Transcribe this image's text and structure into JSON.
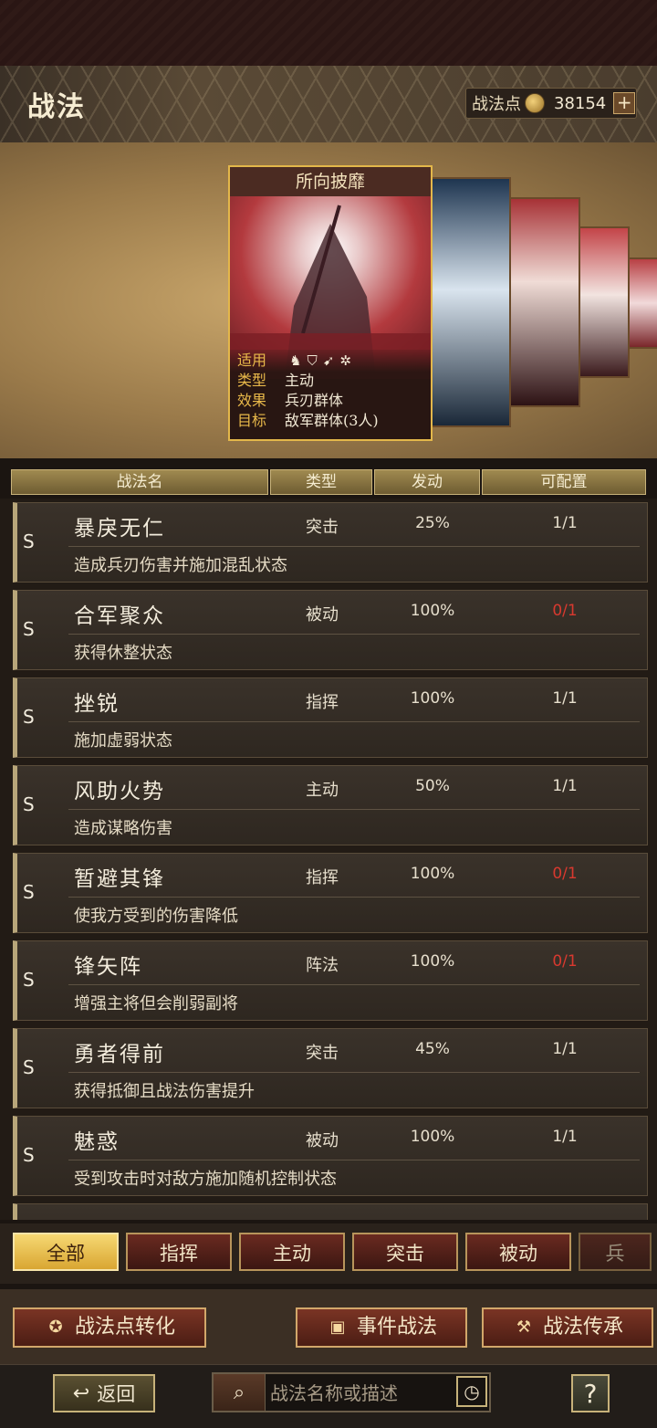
{
  "header": {
    "title": "战法",
    "points_label": "战法点",
    "points_value": "38154",
    "plus_icon": "plus-icon",
    "coin_icon": "coin-icon"
  },
  "featured": {
    "name": "所向披靡",
    "rows": [
      {
        "key": "适用",
        "value": ""
      },
      {
        "key": "类型",
        "value": "主动"
      },
      {
        "key": "效果",
        "value": "兵刃群体"
      },
      {
        "key": "目标",
        "value": "敌军群体(3人)"
      }
    ],
    "applicable_icons": [
      "cavalry-icon",
      "shield-icon",
      "bow-icon",
      "wheel-icon"
    ]
  },
  "columns": {
    "name": "战法名",
    "type": "类型",
    "rate": "发动",
    "config": "可配置"
  },
  "skills": [
    {
      "grade": "S",
      "name": "暴戾无仁",
      "type": "突击",
      "rate": "25%",
      "config": "1/1",
      "config_red": false,
      "desc": "造成兵刃伤害并施加混乱状态"
    },
    {
      "grade": "S",
      "name": "合军聚众",
      "type": "被动",
      "rate": "100%",
      "config": "0/1",
      "config_red": true,
      "desc": "获得休整状态"
    },
    {
      "grade": "S",
      "name": "挫锐",
      "type": "指挥",
      "rate": "100%",
      "config": "1/1",
      "config_red": false,
      "desc": "施加虚弱状态"
    },
    {
      "grade": "S",
      "name": "风助火势",
      "type": "主动",
      "rate": "50%",
      "config": "1/1",
      "config_red": false,
      "desc": "造成谋略伤害"
    },
    {
      "grade": "S",
      "name": "暂避其锋",
      "type": "指挥",
      "rate": "100%",
      "config": "0/1",
      "config_red": true,
      "desc": "使我方受到的伤害降低"
    },
    {
      "grade": "S",
      "name": "锋矢阵",
      "type": "阵法",
      "rate": "100%",
      "config": "0/1",
      "config_red": true,
      "desc": "增强主将但会削弱副将"
    },
    {
      "grade": "S",
      "name": "勇者得前",
      "type": "突击",
      "rate": "45%",
      "config": "1/1",
      "config_red": false,
      "desc": "获得抵御且战法伤害提升"
    },
    {
      "grade": "S",
      "name": "魅惑",
      "type": "被动",
      "rate": "100%",
      "config": "1/1",
      "config_red": false,
      "desc": "受到攻击时对敌方施加随机控制状态"
    },
    {
      "grade": "",
      "name": "",
      "type": "",
      "rate": "",
      "config": "",
      "config_red": false,
      "desc": ""
    }
  ],
  "tabs": [
    {
      "label": "全部",
      "active": true
    },
    {
      "label": "指挥",
      "active": false
    },
    {
      "label": "主动",
      "active": false
    },
    {
      "label": "突击",
      "active": false
    },
    {
      "label": "被动",
      "active": false
    },
    {
      "label": "兵",
      "active": false
    }
  ],
  "actions": {
    "convert": "战法点转化",
    "event": "事件战法",
    "inherit": "战法传承"
  },
  "footer": {
    "back": "返回",
    "search_placeholder": "战法名称或描述",
    "help": "?"
  },
  "colors": {
    "accent_gold": "#e3b74a",
    "config_red": "#d8392f",
    "tab_active": "#f6d873"
  }
}
